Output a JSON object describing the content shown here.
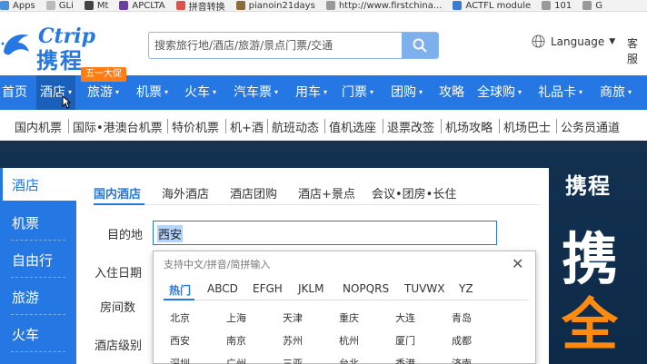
{
  "bookmarks": [
    {
      "label": "Apps",
      "color": "#4a90d9"
    },
    {
      "label": "GLi",
      "color": "#888888"
    },
    {
      "label": "Mt",
      "color": "#444444"
    },
    {
      "label": "APCLTA",
      "color": "#6a3fa0"
    },
    {
      "label": "拼音转换",
      "color": "#d9534f"
    },
    {
      "label": "pianoin21days",
      "color": "#8a6d3b"
    },
    {
      "label": "http://www.firstchina...",
      "color": "#999999"
    },
    {
      "label": "ACTFL module",
      "color": "#3a7bd5"
    },
    {
      "label": "101",
      "color": "#999999"
    },
    {
      "label": "G",
      "color": "#999999"
    }
  ],
  "header": {
    "logo_en": "Ctrip",
    "logo_cn": "携程",
    "search_placeholder": "搜索旅行地/酒店/旅游/景点门票/交通",
    "language": "Language",
    "service": "客服"
  },
  "mainnav": {
    "promo_badge": "五一大促",
    "items": [
      "首页",
      "酒店",
      "旅游",
      "机票",
      "火车",
      "汽车票",
      "用车",
      "门票",
      "团购",
      "攻略",
      "全球购",
      "礼品卡",
      "商旅"
    ]
  },
  "subnav": {
    "items": [
      "国内机票",
      "国际•港澳台机票",
      "特价机票",
      "机+酒",
      "航班动态",
      "值机选座",
      "退票改签",
      "机场攻略",
      "机场巴士",
      "公务员通道"
    ]
  },
  "sidemenu": {
    "items": [
      "酒店",
      "机票",
      "自由行",
      "旅游",
      "火车"
    ]
  },
  "hotel": {
    "tabs": [
      "国内酒店",
      "海外酒店",
      "酒店团购",
      "酒店+景点",
      "会议•团房•长住"
    ],
    "labels": {
      "destination": "目的地",
      "checkin": "入住日期",
      "rooms": "房间数",
      "level": "酒店级别"
    },
    "destination_value": "西安"
  },
  "city_dropdown": {
    "hint": "支持中文/拼音/简拼输入",
    "tabs": [
      "热门",
      "ABCD",
      "EFGH",
      "JKLM",
      "NOPQRS",
      "TUVWX",
      "YZ"
    ],
    "rows": [
      [
        "北京",
        "上海",
        "天津",
        "重庆",
        "大连",
        "青岛"
      ],
      [
        "西安",
        "南京",
        "苏州",
        "杭州",
        "厦门",
        "成都"
      ],
      [
        "深圳",
        "广州",
        "三亚",
        "台北",
        "香港",
        "济南"
      ]
    ]
  },
  "banner": {
    "logo": "携程",
    "big1": "携",
    "big2": "全"
  },
  "colors": {
    "brand_blue": "#2577e3",
    "promo_orange": "#ff7d13",
    "banner_dark": "#12304f"
  }
}
